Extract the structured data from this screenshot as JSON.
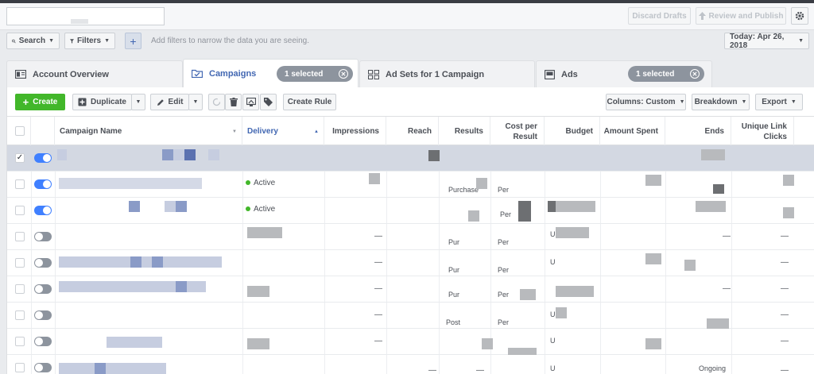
{
  "topbar": {
    "discard_label": "Discard Drafts",
    "review_label": "Review and Publish",
    "icon_settings": "gear-icon"
  },
  "filterbar": {
    "search_label": "Search",
    "filters_label": "Filters",
    "hint": "Add filters to narrow the data you are seeing.",
    "date_label": "Today: Apr 26, 2018"
  },
  "tabs": {
    "account_overview": "Account Overview",
    "campaigns": "Campaigns",
    "campaigns_selected": "1 selected",
    "adsets": "Ad Sets for 1 Campaign",
    "ads": "Ads",
    "ads_selected": "1 selected"
  },
  "toolbar": {
    "create": "Create",
    "duplicate": "Duplicate",
    "edit": "Edit",
    "create_rule": "Create Rule",
    "columns": "Columns: Custom",
    "breakdown": "Breakdown",
    "export": "Export"
  },
  "table": {
    "headers": {
      "campaign_name": "Campaign Name",
      "delivery": "Delivery",
      "impressions": "Impressions",
      "reach": "Reach",
      "results": "Results",
      "cost_per_result": "Cost per Result",
      "budget": "Budget",
      "amount_spent": "Amount Spent",
      "ends": "Ends",
      "unique_link_clicks": "Unique Link Clicks"
    },
    "delivery_active": "Active",
    "dash": "—",
    "res_purchase": "Purchase",
    "res_pur": "Pur",
    "res_post": "Post",
    "cost_per": "Per",
    "budget_u": "U",
    "ends_ongoing": "Ongoing",
    "check_mark": "✓"
  },
  "colors": {
    "accent": "#4267b2",
    "create_green": "#42b72a",
    "toggle_on": "#4080ff"
  }
}
